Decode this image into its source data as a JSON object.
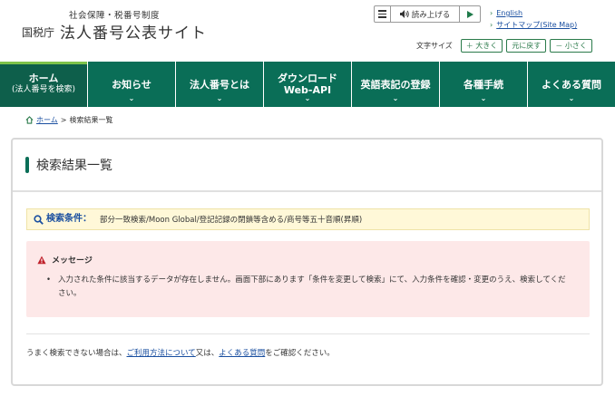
{
  "header": {
    "subtitle": "社会保障・税番号制度",
    "agency": "国税庁",
    "site_name": "法人番号公表サイト"
  },
  "tts": {
    "read_label": "読み上げる"
  },
  "top_links": {
    "english": "English",
    "sitemap": "サイトマップ(Site Map)"
  },
  "font_size": {
    "label": "文字サイズ",
    "larger": "＋ 大きく",
    "reset": "元に戻す",
    "smaller": "－ 小さく"
  },
  "nav": {
    "items": [
      {
        "label": "ホーム",
        "sub": "(法人番号を検索)"
      },
      {
        "label": "お知らせ",
        "sub": ""
      },
      {
        "label": "法人番号とは",
        "sub": ""
      },
      {
        "label": "ダウンロード",
        "sub": "Web-API"
      },
      {
        "label": "英語表記の登録",
        "sub": ""
      },
      {
        "label": "各種手続",
        "sub": ""
      },
      {
        "label": "よくある質問",
        "sub": ""
      }
    ]
  },
  "breadcrumb": {
    "home": "ホーム",
    "sep": ">",
    "current": "検索結果一覧"
  },
  "panel": {
    "title": "検索結果一覧",
    "condition_label": "検索条件：",
    "condition_value": "部分一致検索/Moon Global/登記記録の閉鎖等含める/商号等五十音順(昇順)",
    "message_title": "メッセージ",
    "message_text": "入力された条件に該当するデータが存在しません。画面下部にあります「条件を変更して検索」にて、入力条件を確認・変更のうえ、検索してください。",
    "help_prefix": "うまく検索できない場合は、",
    "help_link1": "ご利用方法について",
    "help_mid": "又は、",
    "help_link2": "よくある質問",
    "help_suffix": "をご確認ください。"
  },
  "colors": {
    "nav_bg": "#0a6e57",
    "nav_active_accent": "#7ec24a",
    "link": "#1a4fa0",
    "message_bg": "#fde8e8",
    "condition_bg": "#fff8d8"
  }
}
